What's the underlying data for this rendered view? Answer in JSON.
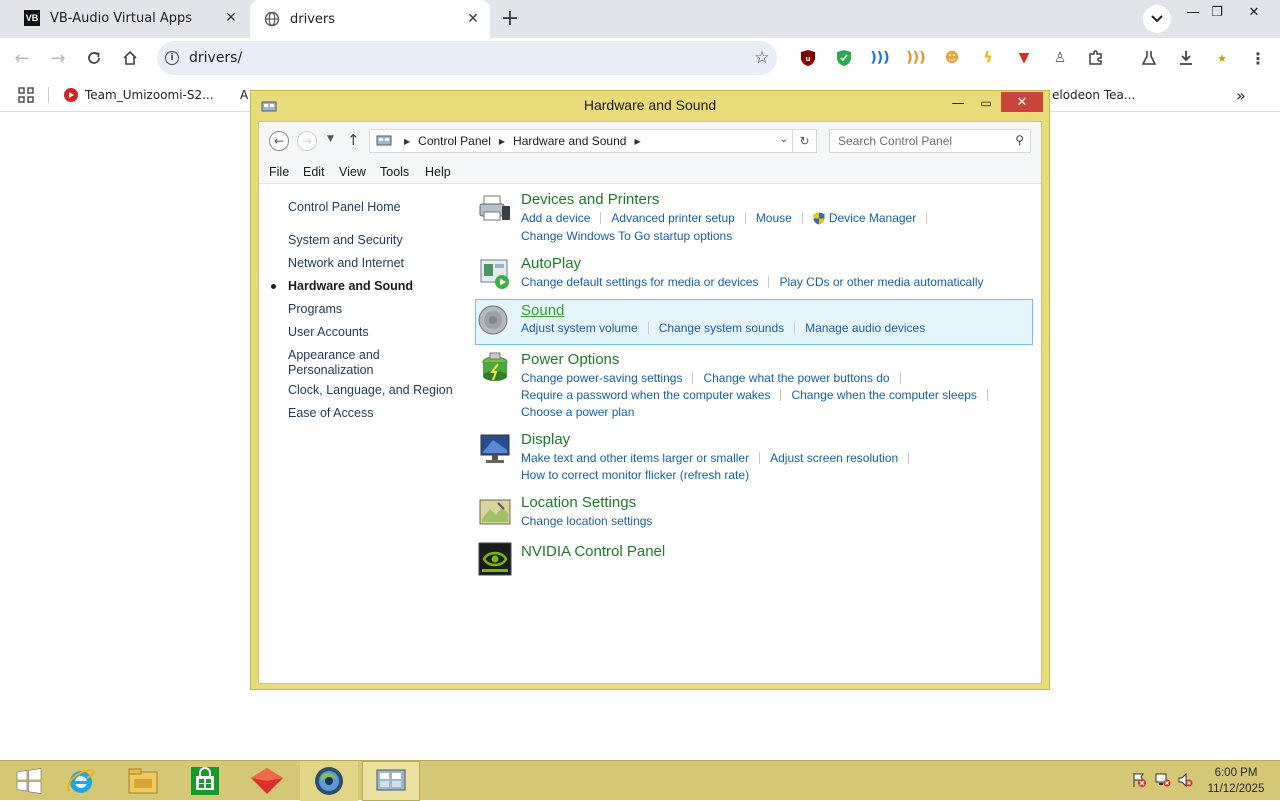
{
  "browser": {
    "tabs": [
      {
        "title": "VB-Audio Virtual Apps",
        "favicon": "vb-logo",
        "active": false
      },
      {
        "title": "drivers",
        "favicon": "globe-icon",
        "active": true
      }
    ],
    "new_tab_symbol": "+",
    "url": "drivers/",
    "bookmarks": [
      {
        "label": "Team_Umizoomi-S2...",
        "icon": "youtube-icon"
      },
      {
        "label": "A",
        "icon": "page-icon"
      },
      {
        "label": "elodeon Tea...",
        "icon": "page-icon"
      }
    ],
    "more_bookmarks_symbol": "»"
  },
  "window": {
    "title": "Hardware and Sound",
    "breadcrumb": [
      "Control Panel",
      "Hardware and Sound"
    ],
    "search_placeholder": "Search Control Panel",
    "menu": [
      "File",
      "Edit",
      "View",
      "Tools",
      "Help"
    ]
  },
  "sidebar": {
    "home": "Control Panel Home",
    "items": [
      {
        "label": "System and Security"
      },
      {
        "label": "Network and Internet"
      },
      {
        "label": "Hardware and Sound",
        "current": true
      },
      {
        "label": "Programs"
      },
      {
        "label": "User Accounts"
      },
      {
        "label": "Appearance and Personalization"
      },
      {
        "label": "Clock, Language, and Region"
      },
      {
        "label": "Ease of Access"
      }
    ]
  },
  "categories": [
    {
      "title": "Devices and Printers",
      "icon": "printer-icon",
      "links": [
        [
          "Add a device",
          "Advanced printer setup",
          "Mouse",
          "Device Manager"
        ],
        [
          "Change Windows To Go startup options"
        ]
      ]
    },
    {
      "title": "AutoPlay",
      "icon": "autoplay-icon",
      "links": [
        [
          "Change default settings for media or devices",
          "Play CDs or other media automatically"
        ]
      ]
    },
    {
      "title": "Sound",
      "icon": "speaker-icon",
      "hover": true,
      "links": [
        [
          "Adjust system volume",
          "Change system sounds",
          "Manage audio devices"
        ]
      ]
    },
    {
      "title": "Power Options",
      "icon": "battery-icon",
      "links": [
        [
          "Change power-saving settings",
          "Change what the power buttons do"
        ],
        [
          "Require a password when the computer wakes",
          "Change when the computer sleeps"
        ],
        [
          "Choose a power plan"
        ]
      ]
    },
    {
      "title": "Display",
      "icon": "monitor-icon",
      "links": [
        [
          "Make text and other items larger or smaller",
          "Adjust screen resolution"
        ],
        [
          "How to correct monitor flicker (refresh rate)"
        ]
      ]
    },
    {
      "title": "Location Settings",
      "icon": "location-icon",
      "links": [
        [
          "Change location settings"
        ]
      ]
    },
    {
      "title": "NVIDIA Control Panel",
      "icon": "nvidia-icon",
      "links": []
    }
  ],
  "taskbar": {
    "apps": [
      "start-icon",
      "internet-explorer-icon",
      "file-explorer-icon",
      "store-icon",
      "app-icon",
      "browser-icon",
      "control-panel-icon"
    ],
    "clock_time": "6:00 PM",
    "clock_date": "11/12/2025"
  }
}
